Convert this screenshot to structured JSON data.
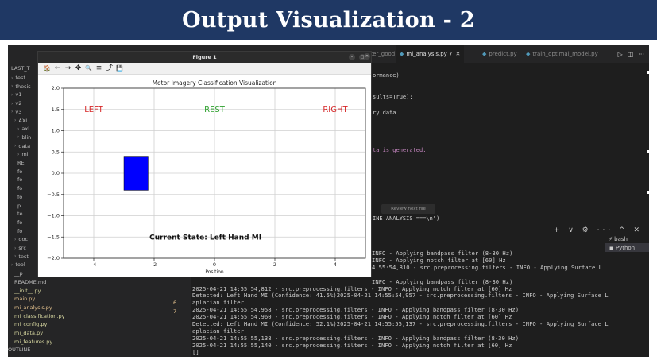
{
  "slide": {
    "title": "Output Visualization - 2",
    "bg": "#1f3864"
  },
  "editor_tabs": [
    {
      "label": "filter_good.pkl",
      "active": false
    },
    {
      "label": "mi_analysis.py 7",
      "active": true
    },
    {
      "label": "predict.py",
      "active": false
    },
    {
      "label": "train_optimal_model.py",
      "active": false
    }
  ],
  "sidebar": {
    "header": "LAST_T",
    "items": [
      "test",
      "thesis",
      "v1",
      "v2",
      "v3",
      "AXL",
      "axl",
      "blin",
      "data",
      "mi",
      "RE",
      "fo",
      "fo",
      "fo",
      "fo",
      "p",
      "te",
      "fo",
      "fo",
      "doc",
      "src",
      "test",
      "tool",
      "__p",
      "README.md",
      "__init__.py",
      "main.py",
      "mi_analysis.py",
      "mi_classification.py",
      "mi_config.py",
      "mi_data.py",
      "mi_features.py",
      "OUTLINE"
    ],
    "badges": {
      "main": "6",
      "mi_analysis": "7"
    }
  },
  "editor_code": [
    "ormance)",
    "sults=True):",
    "ry data",
    "ta is generated.",
    "INE ANALYSIS ===\\n\")"
  ],
  "hover_note": "Review next file",
  "terminal": {
    "lines": [
      "INFO - Applying bandpass filter (8-30 Hz)",
      "INFO - Applying notch filter at [60] Hz",
      "4:55:54,810 - src.preprocessing.filters - INFO - Applying Surface L",
      "",
      "INFO - Applying bandpass filter (8-30 Hz)",
      "2025-04-21 14:55:54,812 - src.preprocessing.filters - INFO - Applying notch filter at [60] Hz",
      "Detected: Left Hand MI (Confidence: 41.5%)2025-04-21 14:55:54,957 - src.preprocessing.filters - INFO - Applying Surface L",
      "aplacian filter",
      "2025-04-21 14:55:54,958 - src.preprocessing.filters - INFO - Applying bandpass filter (8-30 Hz)",
      "2025-04-21 14:55:54,960 - src.preprocessing.filters - INFO - Applying notch filter at [60] Hz",
      "Detected: Left Hand MI (Confidence: 52.1%)2025-04-21 14:55:55,137 - src.preprocessing.filters - INFO - Applying Surface L",
      "aplacian filter",
      "2025-04-21 14:55:55,138 - src.preprocessing.filters - INFO - Applying bandpass filter (8-30 Hz)",
      "2025-04-21 14:55:55,140 - src.preprocessing.filters - INFO - Applying notch filter at [60] Hz",
      "[]"
    ],
    "shells": [
      "bash",
      "Python"
    ],
    "actions": "+ ∨ ⚙ ··· ^ ✕"
  },
  "figure": {
    "window_title": "Figure 1",
    "toolbar_icons": [
      "home-icon",
      "back-icon",
      "forward-icon",
      "pan-icon",
      "zoom-icon",
      "configure-icon",
      "edit-axis-icon",
      "save-icon"
    ],
    "toolbar_glyphs": [
      "🏠",
      "←",
      "→",
      "✥",
      "🔍",
      "≡",
      "⤴",
      "💾"
    ]
  },
  "chart_data": {
    "type": "scatter",
    "title": "Motor Imagery Classification Visualization",
    "xlabel": "Position",
    "ylabel": "",
    "xlim": [
      -5,
      5
    ],
    "ylim": [
      -2.0,
      2.0
    ],
    "xticks": [
      -4,
      -2,
      0,
      2,
      4
    ],
    "yticks": [
      -2.0,
      -1.5,
      -1.0,
      -0.5,
      0.0,
      0.5,
      1.0,
      1.5,
      2.0
    ],
    "grid": true,
    "labels": [
      {
        "text": "LEFT",
        "x": -4,
        "y": 1.5,
        "color": "#d62728"
      },
      {
        "text": "REST",
        "x": 0,
        "y": 1.5,
        "color": "#2ca02c"
      },
      {
        "text": "RIGHT",
        "x": 4,
        "y": 1.5,
        "color": "#d62728"
      }
    ],
    "indicator": {
      "x0": -3.0,
      "x1": -2.2,
      "y0": -0.4,
      "y1": 0.4,
      "color": "#0000ff"
    },
    "state_text": "Current State: Left Hand MI",
    "state_pos": {
      "x": -0.3,
      "y": -1.5
    }
  }
}
